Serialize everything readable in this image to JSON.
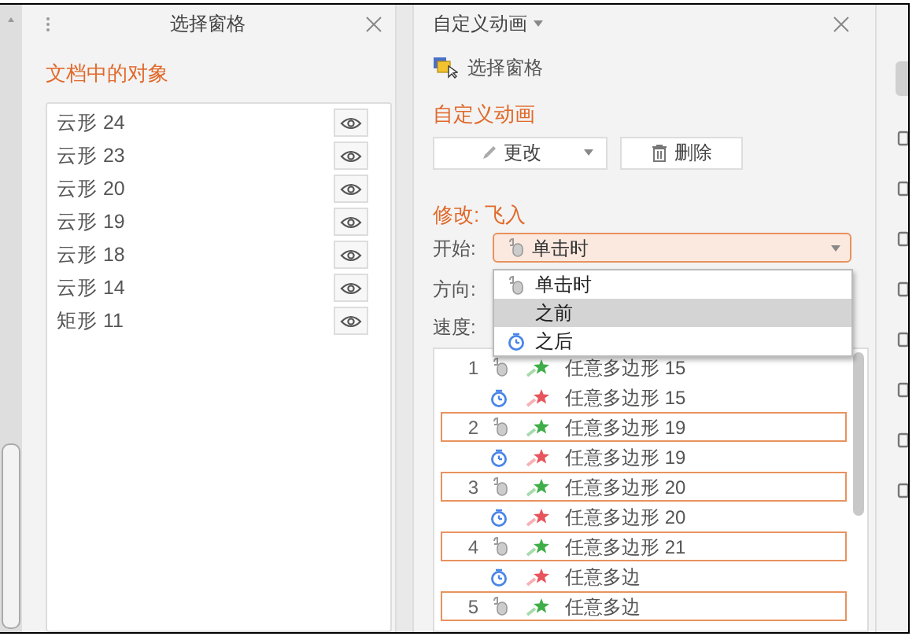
{
  "selection_pane": {
    "title": "选择窗格",
    "heading": "文档中的对象",
    "objects": [
      {
        "name": "云形 24",
        "visible": true
      },
      {
        "name": "云形 23",
        "visible": true
      },
      {
        "name": "云形 20",
        "visible": true
      },
      {
        "name": "云形 19",
        "visible": true
      },
      {
        "name": "云形 18",
        "visible": true
      },
      {
        "name": "云形 14",
        "visible": true
      },
      {
        "name": "矩形 11",
        "visible": true
      }
    ]
  },
  "animation_pane": {
    "title": "自定义动画",
    "select_pane_link": "选择窗格",
    "heading": "自定义动画",
    "change_button": "更改",
    "delete_button": "删除",
    "modify_label": "修改: 飞入",
    "start": {
      "label": "开始:",
      "value": "单击时",
      "kind": "click"
    },
    "direction_label": "方向:",
    "speed_label": "速度:",
    "start_menu": [
      {
        "label": "单击时",
        "kind": "click",
        "selected": false
      },
      {
        "label": "之前",
        "kind": "with",
        "selected": true
      },
      {
        "label": "之后",
        "kind": "after",
        "selected": false
      }
    ],
    "animations": [
      {
        "number": "1",
        "kind": "click",
        "color": "#3fae49",
        "name": "任意多边形 15",
        "selected": false
      },
      {
        "kind": "after",
        "color": "#e8545c",
        "name": "任意多边形 15",
        "selected": false
      },
      {
        "number": "2",
        "kind": "click",
        "color": "#3fae49",
        "name": "任意多边形 19",
        "selected": true
      },
      {
        "kind": "after",
        "color": "#e8545c",
        "name": "任意多边形 19",
        "selected": false
      },
      {
        "number": "3",
        "kind": "click",
        "color": "#3fae49",
        "name": "任意多边形 20",
        "selected": true
      },
      {
        "kind": "after",
        "color": "#e8545c",
        "name": "任意多边形 20",
        "selected": false
      },
      {
        "number": "4",
        "kind": "click",
        "color": "#3fae49",
        "name": "任意多边形 21",
        "selected": true
      },
      {
        "kind": "after",
        "color": "#e8545c",
        "name": "任意多边",
        "selected": false
      },
      {
        "number": "5",
        "kind": "click",
        "color": "#3fae49",
        "name": "任意多边",
        "selected": true
      }
    ]
  }
}
